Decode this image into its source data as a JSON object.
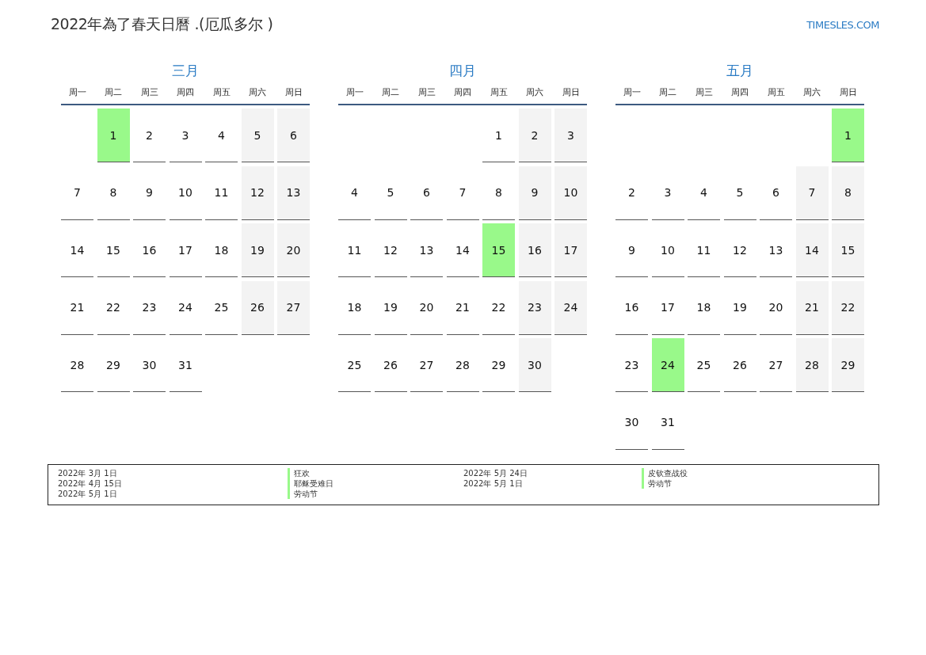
{
  "title": "2022年為了春天日曆 .(厄瓜多尔 )",
  "site": "TIMESLES.COM",
  "months": [
    {
      "name": "三月",
      "weekdays": [
        "周一",
        "周二",
        "周三",
        "周四",
        "周五",
        "周六",
        "周日"
      ],
      "weeks": [
        [
          {
            "kind": "blank"
          },
          {
            "kind": "day",
            "day": "1",
            "holiday": true,
            "weekend": false
          },
          {
            "kind": "day",
            "day": "2",
            "holiday": false,
            "weekend": false
          },
          {
            "kind": "day",
            "day": "3",
            "holiday": false,
            "weekend": false
          },
          {
            "kind": "day",
            "day": "4",
            "holiday": false,
            "weekend": false
          },
          {
            "kind": "day",
            "day": "5",
            "holiday": false,
            "weekend": true
          },
          {
            "kind": "day",
            "day": "6",
            "holiday": false,
            "weekend": true
          }
        ],
        [
          {
            "kind": "day",
            "day": "7",
            "holiday": false,
            "weekend": false
          },
          {
            "kind": "day",
            "day": "8",
            "holiday": false,
            "weekend": false
          },
          {
            "kind": "day",
            "day": "9",
            "holiday": false,
            "weekend": false
          },
          {
            "kind": "day",
            "day": "10",
            "holiday": false,
            "weekend": false
          },
          {
            "kind": "day",
            "day": "11",
            "holiday": false,
            "weekend": false
          },
          {
            "kind": "day",
            "day": "12",
            "holiday": false,
            "weekend": true
          },
          {
            "kind": "day",
            "day": "13",
            "holiday": false,
            "weekend": true
          }
        ],
        [
          {
            "kind": "day",
            "day": "14",
            "holiday": false,
            "weekend": false
          },
          {
            "kind": "day",
            "day": "15",
            "holiday": false,
            "weekend": false
          },
          {
            "kind": "day",
            "day": "16",
            "holiday": false,
            "weekend": false
          },
          {
            "kind": "day",
            "day": "17",
            "holiday": false,
            "weekend": false
          },
          {
            "kind": "day",
            "day": "18",
            "holiday": false,
            "weekend": false
          },
          {
            "kind": "day",
            "day": "19",
            "holiday": false,
            "weekend": true
          },
          {
            "kind": "day",
            "day": "20",
            "holiday": false,
            "weekend": true
          }
        ],
        [
          {
            "kind": "day",
            "day": "21",
            "holiday": false,
            "weekend": false
          },
          {
            "kind": "day",
            "day": "22",
            "holiday": false,
            "weekend": false
          },
          {
            "kind": "day",
            "day": "23",
            "holiday": false,
            "weekend": false
          },
          {
            "kind": "day",
            "day": "24",
            "holiday": false,
            "weekend": false
          },
          {
            "kind": "day",
            "day": "25",
            "holiday": false,
            "weekend": false
          },
          {
            "kind": "day",
            "day": "26",
            "holiday": false,
            "weekend": true
          },
          {
            "kind": "day",
            "day": "27",
            "holiday": false,
            "weekend": true
          }
        ],
        [
          {
            "kind": "day",
            "day": "28",
            "holiday": false,
            "weekend": false
          },
          {
            "kind": "day",
            "day": "29",
            "holiday": false,
            "weekend": false
          },
          {
            "kind": "day",
            "day": "30",
            "holiday": false,
            "weekend": false
          },
          {
            "kind": "day",
            "day": "31",
            "holiday": false,
            "weekend": false
          },
          {
            "kind": "blank"
          },
          {
            "kind": "blank"
          },
          {
            "kind": "blank"
          }
        ]
      ]
    },
    {
      "name": "四月",
      "weekdays": [
        "周一",
        "周二",
        "周三",
        "周四",
        "周五",
        "周六",
        "周日"
      ],
      "weeks": [
        [
          {
            "kind": "blank"
          },
          {
            "kind": "blank"
          },
          {
            "kind": "blank"
          },
          {
            "kind": "blank"
          },
          {
            "kind": "day",
            "day": "1",
            "holiday": false,
            "weekend": false
          },
          {
            "kind": "day",
            "day": "2",
            "holiday": false,
            "weekend": true
          },
          {
            "kind": "day",
            "day": "3",
            "holiday": false,
            "weekend": true
          }
        ],
        [
          {
            "kind": "day",
            "day": "4",
            "holiday": false,
            "weekend": false
          },
          {
            "kind": "day",
            "day": "5",
            "holiday": false,
            "weekend": false
          },
          {
            "kind": "day",
            "day": "6",
            "holiday": false,
            "weekend": false
          },
          {
            "kind": "day",
            "day": "7",
            "holiday": false,
            "weekend": false
          },
          {
            "kind": "day",
            "day": "8",
            "holiday": false,
            "weekend": false
          },
          {
            "kind": "day",
            "day": "9",
            "holiday": false,
            "weekend": true
          },
          {
            "kind": "day",
            "day": "10",
            "holiday": false,
            "weekend": true
          }
        ],
        [
          {
            "kind": "day",
            "day": "11",
            "holiday": false,
            "weekend": false
          },
          {
            "kind": "day",
            "day": "12",
            "holiday": false,
            "weekend": false
          },
          {
            "kind": "day",
            "day": "13",
            "holiday": false,
            "weekend": false
          },
          {
            "kind": "day",
            "day": "14",
            "holiday": false,
            "weekend": false
          },
          {
            "kind": "day",
            "day": "15",
            "holiday": true,
            "weekend": false
          },
          {
            "kind": "day",
            "day": "16",
            "holiday": false,
            "weekend": true
          },
          {
            "kind": "day",
            "day": "17",
            "holiday": false,
            "weekend": true
          }
        ],
        [
          {
            "kind": "day",
            "day": "18",
            "holiday": false,
            "weekend": false
          },
          {
            "kind": "day",
            "day": "19",
            "holiday": false,
            "weekend": false
          },
          {
            "kind": "day",
            "day": "20",
            "holiday": false,
            "weekend": false
          },
          {
            "kind": "day",
            "day": "21",
            "holiday": false,
            "weekend": false
          },
          {
            "kind": "day",
            "day": "22",
            "holiday": false,
            "weekend": false
          },
          {
            "kind": "day",
            "day": "23",
            "holiday": false,
            "weekend": true
          },
          {
            "kind": "day",
            "day": "24",
            "holiday": false,
            "weekend": true
          }
        ],
        [
          {
            "kind": "day",
            "day": "25",
            "holiday": false,
            "weekend": false
          },
          {
            "kind": "day",
            "day": "26",
            "holiday": false,
            "weekend": false
          },
          {
            "kind": "day",
            "day": "27",
            "holiday": false,
            "weekend": false
          },
          {
            "kind": "day",
            "day": "28",
            "holiday": false,
            "weekend": false
          },
          {
            "kind": "day",
            "day": "29",
            "holiday": false,
            "weekend": false
          },
          {
            "kind": "day",
            "day": "30",
            "holiday": false,
            "weekend": true
          },
          {
            "kind": "blank"
          }
        ]
      ]
    },
    {
      "name": "五月",
      "weekdays": [
        "周一",
        "周二",
        "周三",
        "周四",
        "周五",
        "周六",
        "周日"
      ],
      "weeks": [
        [
          {
            "kind": "blank"
          },
          {
            "kind": "blank"
          },
          {
            "kind": "blank"
          },
          {
            "kind": "blank"
          },
          {
            "kind": "blank"
          },
          {
            "kind": "blank"
          },
          {
            "kind": "day",
            "day": "1",
            "holiday": true
          }
        ],
        [
          {
            "kind": "day",
            "day": "2",
            "holiday": false,
            "weekend": false
          },
          {
            "kind": "day",
            "day": "3",
            "holiday": false,
            "weekend": false
          },
          {
            "kind": "day",
            "day": "4",
            "holiday": false,
            "weekend": false
          },
          {
            "kind": "day",
            "day": "5",
            "holiday": false,
            "weekend": false
          },
          {
            "kind": "day",
            "day": "6",
            "holiday": false,
            "weekend": false
          },
          {
            "kind": "day",
            "day": "7",
            "holiday": false,
            "weekend": true
          },
          {
            "kind": "day",
            "day": "8",
            "holiday": false,
            "weekend": true
          }
        ],
        [
          {
            "kind": "day",
            "day": "9",
            "holiday": false,
            "weekend": false
          },
          {
            "kind": "day",
            "day": "10",
            "holiday": false,
            "weekend": false
          },
          {
            "kind": "day",
            "day": "11",
            "holiday": false,
            "weekend": false
          },
          {
            "kind": "day",
            "day": "12",
            "holiday": false,
            "weekend": false
          },
          {
            "kind": "day",
            "day": "13",
            "holiday": false,
            "weekend": false
          },
          {
            "kind": "day",
            "day": "14",
            "holiday": false,
            "weekend": true
          },
          {
            "kind": "day",
            "day": "15",
            "holiday": false,
            "weekend": true
          }
        ],
        [
          {
            "kind": "day",
            "day": "16",
            "holiday": false,
            "weekend": false
          },
          {
            "kind": "day",
            "day": "17",
            "holiday": false,
            "weekend": false
          },
          {
            "kind": "day",
            "day": "18",
            "holiday": false,
            "weekend": false
          },
          {
            "kind": "day",
            "day": "19",
            "holiday": false,
            "weekend": false
          },
          {
            "kind": "day",
            "day": "20",
            "holiday": false,
            "weekend": false
          },
          {
            "kind": "day",
            "day": "21",
            "holiday": false,
            "weekend": true
          },
          {
            "kind": "day",
            "day": "22",
            "holiday": false,
            "weekend": true
          }
        ],
        [
          {
            "kind": "day",
            "day": "23",
            "holiday": false,
            "weekend": false
          },
          {
            "kind": "day",
            "day": "24",
            "holiday": true,
            "weekend": false
          },
          {
            "kind": "day",
            "day": "25",
            "holiday": false,
            "weekend": false
          },
          {
            "kind": "day",
            "day": "26",
            "holiday": false,
            "weekend": false
          },
          {
            "kind": "day",
            "day": "27",
            "holiday": false,
            "weekend": false
          },
          {
            "kind": "day",
            "day": "28",
            "holiday": false,
            "weekend": true
          },
          {
            "kind": "day",
            "day": "29",
            "holiday": false,
            "weekend": true
          }
        ],
        [
          {
            "kind": "day",
            "day": "30",
            "holiday": false,
            "weekend": false
          },
          {
            "kind": "day",
            "day": "31",
            "holiday": false,
            "weekend": false
          },
          {
            "kind": "blank"
          },
          {
            "kind": "blank"
          },
          {
            "kind": "blank"
          },
          {
            "kind": "blank"
          },
          {
            "kind": "blank"
          }
        ]
      ]
    }
  ],
  "legend": [
    [
      {
        "date": "2022年 3月 1日",
        "name": "狂欢"
      },
      {
        "date": "2022年 4月 15日",
        "name": "耶稣受难日"
      },
      {
        "date": "2022年 5月 1日",
        "name": "劳动节"
      }
    ],
    [
      {
        "date": "2022年 5月 24日",
        "name": "皮钦查战役"
      },
      {
        "date": "2022年 5月 1日",
        "name": "劳动节"
      }
    ]
  ]
}
